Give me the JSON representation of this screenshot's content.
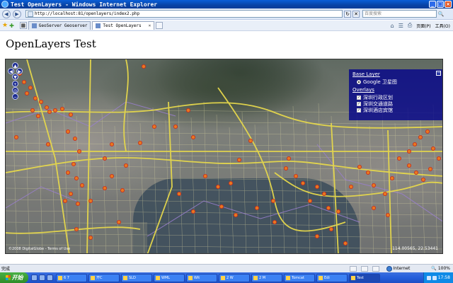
{
  "window": {
    "title": "Test OpenLayers - Windows Internet Explorer",
    "controls": {
      "minimize": "_",
      "maximize": "□",
      "close": "×"
    }
  },
  "addressbar": {
    "back": "◀",
    "forward": "▶",
    "url": "http://localhost:81/openlayers/index2.php",
    "refresh": "↻",
    "stop": "✕",
    "search_placeholder": "百度搜索",
    "search_button": "🔍"
  },
  "tabs": {
    "items": [
      {
        "label": "GeoServer Geoserver",
        "active": false
      },
      {
        "label": "Test OpenLayers",
        "active": true
      }
    ],
    "close": "×"
  },
  "toolbar": {
    "home": "⌂",
    "feeds": "☰",
    "print": "⎙",
    "page_label": "页面(P)",
    "tools_label": "工具(O)"
  },
  "page": {
    "heading": "OpenLayers Test"
  },
  "map": {
    "pan": {
      "up": "▲",
      "left": "◀",
      "right": "▶",
      "down": "▼",
      "zoom_in": "+",
      "zoom_world": "◎",
      "zoom_out": "−"
    },
    "layer_switcher": {
      "base_heading": "Base Layer",
      "base_layers": [
        {
          "label": "Google 卫星图",
          "selected": true
        }
      ],
      "overlays_heading": "Overlays",
      "overlays": [
        {
          "label": "深圳行政区划",
          "checked": true
        },
        {
          "label": "深圳交通道路",
          "checked": true
        },
        {
          "label": "深圳酒店宾馆",
          "checked": true
        }
      ],
      "minimize": "−"
    },
    "attribution": "©2008 DigitalGlobe - Terms of Use",
    "mouse_position": "114.00565, 22.53441"
  },
  "statusbar": {
    "text": "完成",
    "zone": "Internet",
    "zoom": "100%"
  },
  "taskbar": {
    "start_label": "开始",
    "tasks": [
      {
        "label": "6 7",
        "active": false
      },
      {
        "label": "开C",
        "active": false
      },
      {
        "label": "SLD",
        "active": false
      },
      {
        "label": "WML",
        "active": false
      },
      {
        "label": "Wit",
        "active": false
      },
      {
        "label": "2 W",
        "active": false
      },
      {
        "label": "2 M",
        "active": false
      },
      {
        "label": "Tomcat",
        "active": false
      },
      {
        "label": "Edi",
        "active": false
      },
      {
        "label": "Test",
        "active": true
      }
    ],
    "clock": "17:58"
  },
  "colors": {
    "titlebar": "#0843a6",
    "layer_switcher_bg": "#00008c",
    "road": "#e6d84c",
    "poi_fill": "#e8781e",
    "poi_stroke": "#c8281e",
    "boundary": "#9a7fd0"
  }
}
